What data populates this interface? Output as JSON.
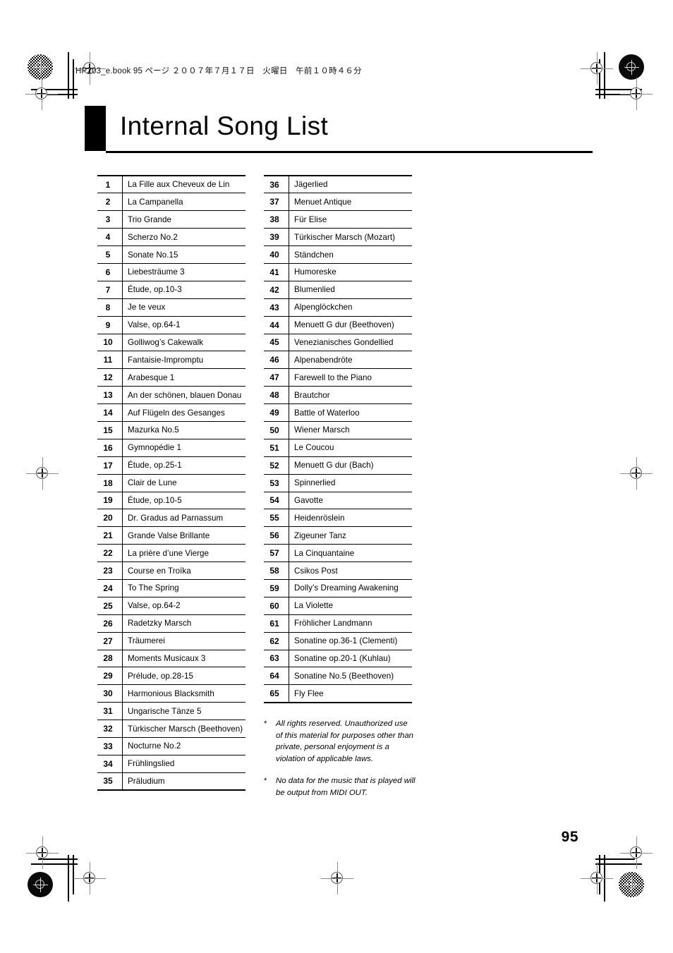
{
  "sheet": {
    "header_line": "HP203_e.book 95 ページ ２００７年７月１７日　火曜日　午前１０時４６分",
    "page_number": "95"
  },
  "title": {
    "text": "Internal Song List"
  },
  "songs": {
    "left_column": [
      {
        "number": "1",
        "name": "La Fille aux Cheveux de Lin"
      },
      {
        "number": "2",
        "name": "La Campanella"
      },
      {
        "number": "3",
        "name": "Trio Grande"
      },
      {
        "number": "4",
        "name": "Scherzo No.2"
      },
      {
        "number": "5",
        "name": "Sonate No.15"
      },
      {
        "number": "6",
        "name": "Liebesträume 3"
      },
      {
        "number": "7",
        "name": "Étude, op.10-3"
      },
      {
        "number": "8",
        "name": "Je te veux"
      },
      {
        "number": "9",
        "name": "Valse, op.64-1"
      },
      {
        "number": "10",
        "name": "Golliwog’s Cakewalk"
      },
      {
        "number": "11",
        "name": "Fantaisie-Impromptu"
      },
      {
        "number": "12",
        "name": "Arabesque 1"
      },
      {
        "number": "13",
        "name": "An der schönen, blauen Donau"
      },
      {
        "number": "14",
        "name": "Auf Flügeln des Gesanges"
      },
      {
        "number": "15",
        "name": "Mazurka No.5"
      },
      {
        "number": "16",
        "name": "Gymnopédie 1"
      },
      {
        "number": "17",
        "name": "Étude, op.25-1"
      },
      {
        "number": "18",
        "name": "Clair de Lune"
      },
      {
        "number": "19",
        "name": "Étude, op.10-5"
      },
      {
        "number": "20",
        "name": "Dr. Gradus ad Parnassum"
      },
      {
        "number": "21",
        "name": "Grande Valse Brillante"
      },
      {
        "number": "22",
        "name": "La prière d’une Vierge"
      },
      {
        "number": "23",
        "name": "Course en Troïka"
      },
      {
        "number": "24",
        "name": "To The Spring"
      },
      {
        "number": "25",
        "name": "Valse, op.64-2"
      },
      {
        "number": "26",
        "name": "Radetzky Marsch"
      },
      {
        "number": "27",
        "name": "Träumerei"
      },
      {
        "number": "28",
        "name": "Moments Musicaux 3"
      },
      {
        "number": "29",
        "name": "Prélude, op.28-15"
      },
      {
        "number": "30",
        "name": "Harmonious Blacksmith"
      },
      {
        "number": "31",
        "name": "Ungarische Tänze 5"
      },
      {
        "number": "32",
        "name": "Türkischer Marsch (Beethoven)"
      },
      {
        "number": "33",
        "name": "Nocturne No.2"
      },
      {
        "number": "34",
        "name": "Frühlingslied"
      },
      {
        "number": "35",
        "name": "Präludium"
      }
    ],
    "right_column": [
      {
        "number": "36",
        "name": "Jägerlied"
      },
      {
        "number": "37",
        "name": "Menuet Antique"
      },
      {
        "number": "38",
        "name": "Für Elise"
      },
      {
        "number": "39",
        "name": "Türkischer Marsch (Mozart)"
      },
      {
        "number": "40",
        "name": "Ständchen"
      },
      {
        "number": "41",
        "name": "Humoreske"
      },
      {
        "number": "42",
        "name": "Blumenlied"
      },
      {
        "number": "43",
        "name": "Alpenglöckchen"
      },
      {
        "number": "44",
        "name": "Menuett G dur (Beethoven)"
      },
      {
        "number": "45",
        "name": "Venezianisches Gondellied"
      },
      {
        "number": "46",
        "name": "Alpenabendröte"
      },
      {
        "number": "47",
        "name": "Farewell to the Piano"
      },
      {
        "number": "48",
        "name": "Brautchor"
      },
      {
        "number": "49",
        "name": "Battle of Waterloo"
      },
      {
        "number": "50",
        "name": "Wiener Marsch"
      },
      {
        "number": "51",
        "name": "Le Coucou"
      },
      {
        "number": "52",
        "name": "Menuett G dur (Bach)"
      },
      {
        "number": "53",
        "name": "Spinnerlied"
      },
      {
        "number": "54",
        "name": "Gavotte"
      },
      {
        "number": "55",
        "name": "Heidenröslein"
      },
      {
        "number": "56",
        "name": "Zigeuner Tanz"
      },
      {
        "number": "57",
        "name": "La Cinquantaine"
      },
      {
        "number": "58",
        "name": "Csikos Post"
      },
      {
        "number": "59",
        "name": "Dolly’s Dreaming Awakening"
      },
      {
        "number": "60",
        "name": "La Violette"
      },
      {
        "number": "61",
        "name": "Fröhlicher Landmann"
      },
      {
        "number": "62",
        "name": "Sonatine op.36-1 (Clementi)"
      },
      {
        "number": "63",
        "name": "Sonatine op.20-1 (Kuhlau)"
      },
      {
        "number": "64",
        "name": "Sonatine No.5 (Beethoven)"
      },
      {
        "number": "65",
        "name": "Fly Flee"
      }
    ]
  },
  "footnotes": [
    {
      "marker": "*",
      "text": "All rights reserved. Unauthorized use of this material for purposes other than private, personal enjoyment is a violation of applicable laws."
    },
    {
      "marker": "*",
      "text": "No data for the music that is played will be output from MIDI OUT."
    }
  ]
}
